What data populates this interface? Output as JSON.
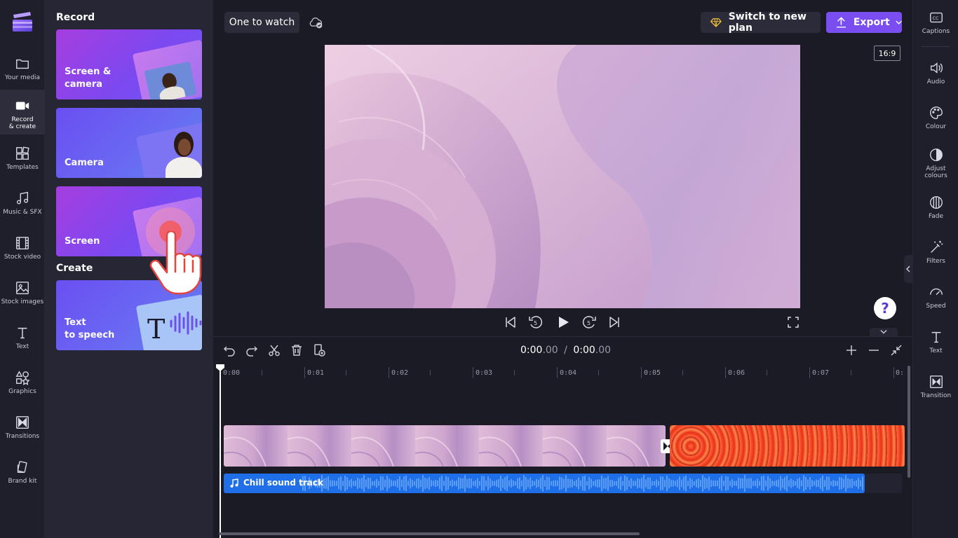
{
  "nav": {
    "items": [
      {
        "label": "Your media",
        "icon": "folder-icon"
      },
      {
        "label": "Record\n& create",
        "icon": "video-camera-icon"
      },
      {
        "label": "Templates",
        "icon": "templates-icon"
      },
      {
        "label": "Music & SFX",
        "icon": "music-note-icon"
      },
      {
        "label": "Stock video",
        "icon": "film-icon"
      },
      {
        "label": "Stock images",
        "icon": "image-icon"
      },
      {
        "label": "Text",
        "icon": "text-icon"
      },
      {
        "label": "Graphics",
        "icon": "shapes-icon"
      },
      {
        "label": "Transitions",
        "icon": "transition-icon"
      },
      {
        "label": "Brand kit",
        "icon": "brand-kit-icon"
      }
    ]
  },
  "panel": {
    "record_title": "Record",
    "create_title": "Create",
    "cards": {
      "screen_camera": "Screen &\ncamera",
      "camera": "Camera",
      "screen": "Screen",
      "tts": "Text\nto speech"
    }
  },
  "topbar": {
    "project_name": "One to watch",
    "switch_plan": "Switch to new plan",
    "export": "Export"
  },
  "preview": {
    "aspect_ratio": "16:9"
  },
  "right_rail": {
    "items": [
      {
        "label": "Captions",
        "icon": "captions-icon"
      },
      {
        "label": "Audio",
        "icon": "speaker-icon"
      },
      {
        "label": "Colour",
        "icon": "palette-icon"
      },
      {
        "label": "Adjust\ncolours",
        "icon": "contrast-icon"
      },
      {
        "label": "Fade",
        "icon": "fade-icon"
      },
      {
        "label": "Filters",
        "icon": "magic-wand-icon"
      },
      {
        "label": "Speed",
        "icon": "speedometer-icon"
      },
      {
        "label": "Text",
        "icon": "text-icon"
      },
      {
        "label": "Transition",
        "icon": "transition-icon"
      }
    ]
  },
  "timeline": {
    "current_time_main": "0:00",
    "current_time_frac": ".00",
    "separator": "/",
    "total_time_main": "0:00",
    "total_time_frac": ".00",
    "ticks": [
      "0:00",
      "0:01",
      "0:02",
      "0:03",
      "0:04",
      "0:05",
      "0:06",
      "0:07",
      "0:"
    ],
    "audio_track_name": "Chill sound track"
  },
  "colors": {
    "accent": "#7a4df0",
    "audio_clip": "#1f6fe8"
  }
}
